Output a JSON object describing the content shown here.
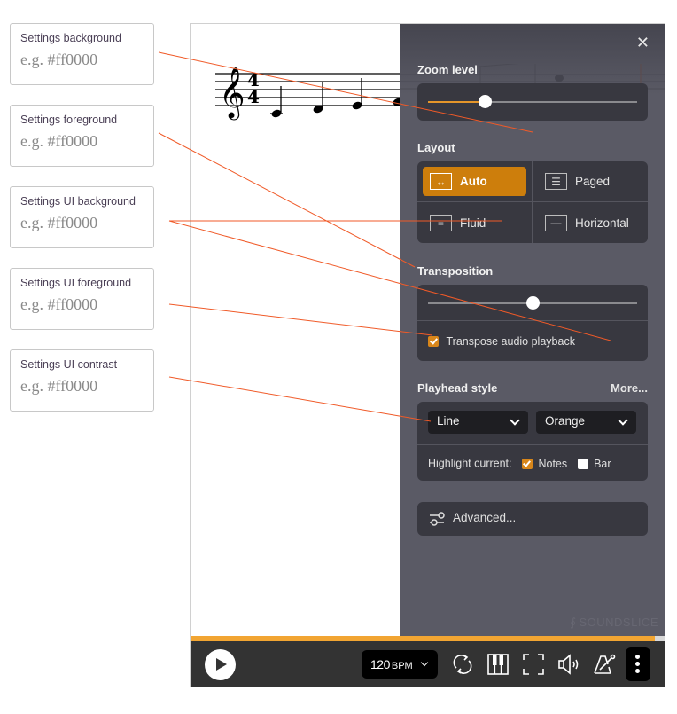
{
  "settings_inputs": [
    {
      "label": "Settings background",
      "placeholder": "e.g. #ff0000",
      "value": ""
    },
    {
      "label": "Settings foreground",
      "placeholder": "e.g. #ff0000",
      "value": ""
    },
    {
      "label": "Settings UI background",
      "placeholder": "e.g. #ff0000",
      "value": ""
    },
    {
      "label": "Settings UI foreground",
      "placeholder": "e.g. #ff0000",
      "value": ""
    },
    {
      "label": "Settings UI contrast",
      "placeholder": "e.g. #ff0000",
      "value": ""
    }
  ],
  "score": {
    "clef": "treble-clef",
    "time_signature": "4/4"
  },
  "panel": {
    "close_icon": "close-icon",
    "zoom": {
      "title": "Zoom level",
      "value_fraction": 0.27
    },
    "layout": {
      "title": "Layout",
      "options": [
        {
          "label": "Auto",
          "icon": "auto-width-icon",
          "glyph": "↔",
          "active": true
        },
        {
          "label": "Paged",
          "icon": "paged-icon",
          "glyph": "☰",
          "active": false
        },
        {
          "label": "Fluid",
          "icon": "fluid-icon",
          "glyph": "≡",
          "active": false
        },
        {
          "label": "Horizontal",
          "icon": "horizontal-icon",
          "glyph": "—",
          "active": false
        }
      ]
    },
    "transposition": {
      "title": "Transposition",
      "value_fraction": 0.5,
      "transpose_audio_label": "Transpose audio playback",
      "transpose_audio_checked": true
    },
    "playhead": {
      "title": "Playhead style",
      "more_label": "More...",
      "style_value": "Line",
      "color_value": "Orange",
      "highlight_label": "Highlight current:",
      "notes_label": "Notes",
      "notes_checked": true,
      "bar_label": "Bar",
      "bar_checked": false
    },
    "advanced_label": "Advanced...",
    "brand": "SOUNDSLICE"
  },
  "player": {
    "progress_fraction": 0.977,
    "tempo_value": "120",
    "tempo_unit": "BPM"
  },
  "colors": {
    "accent": "#cd7e0c",
    "progress": "#f2a532",
    "leader_line": "#f05a28",
    "panel_bg": "#5a5a65",
    "toolbar_bg": "#333333"
  }
}
